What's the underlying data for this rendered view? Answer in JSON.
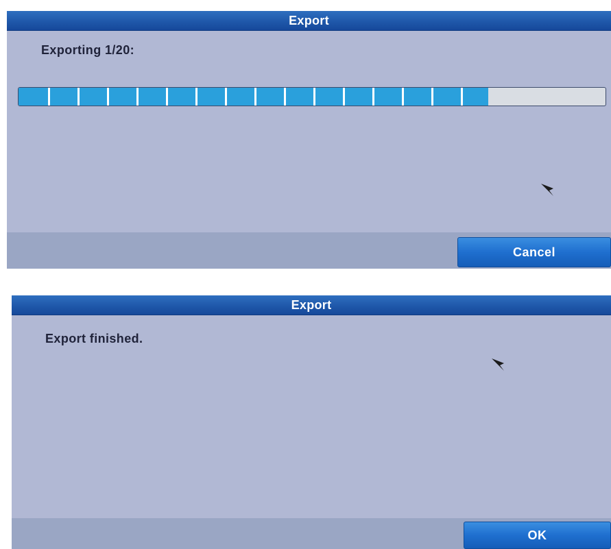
{
  "export_progress_dialog": {
    "title": "Export",
    "message": "Exporting 1/20:",
    "progress_fraction": 0.8,
    "progress_segments": 16,
    "cancel_label": "Cancel"
  },
  "export_finished_dialog": {
    "title": "Export",
    "message": "Export finished.",
    "ok_label": "OK"
  },
  "icons": {
    "pointer": "mouse-pointer-icon"
  },
  "colors": {
    "titlebar": "#1f58aa",
    "dialog_body": "#b1b8d4",
    "footer": "#9aa6c4",
    "progress_fill": "#2aa0dc",
    "progress_track": "#d9dde3",
    "button": "#1f6fcf"
  }
}
